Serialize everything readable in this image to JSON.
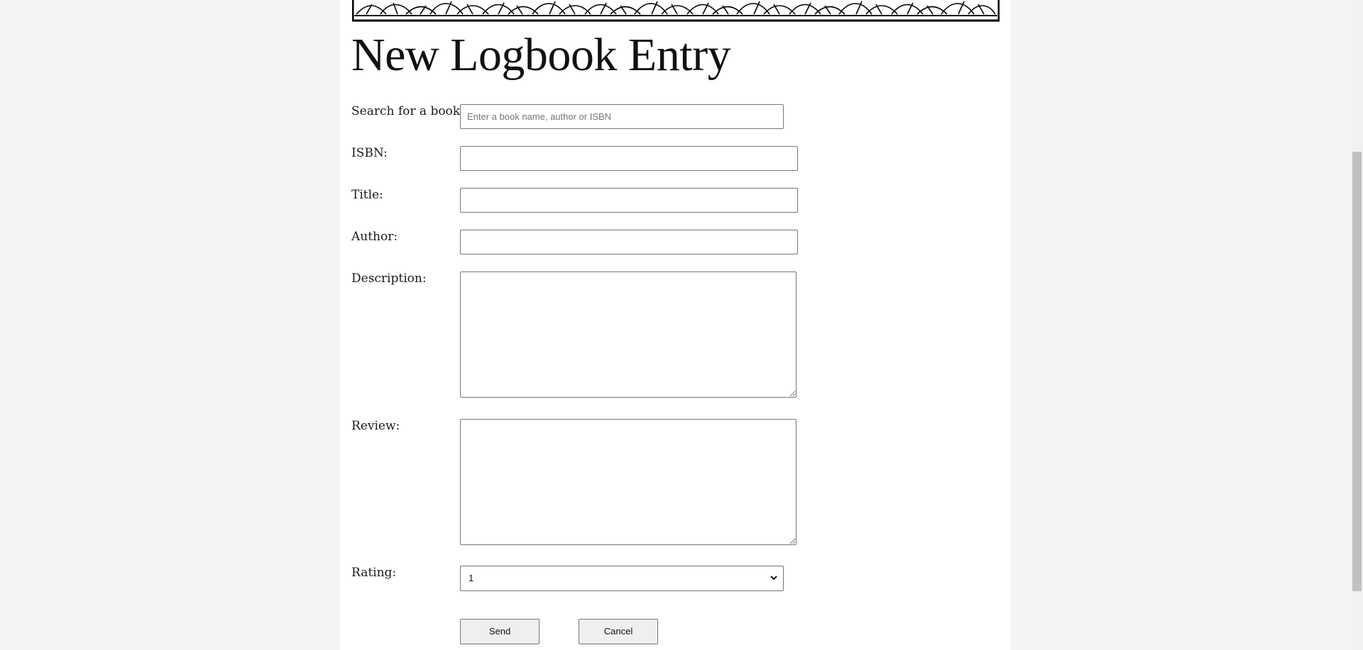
{
  "page": {
    "heading": "New Logbook Entry"
  },
  "form": {
    "search": {
      "label": "Search for a book:",
      "placeholder": "Enter a book name, author or ISBN",
      "value": ""
    },
    "isbn": {
      "label": "ISBN:",
      "value": ""
    },
    "title": {
      "label": "Title:",
      "value": ""
    },
    "author": {
      "label": "Author:",
      "value": ""
    },
    "description": {
      "label": "Description:",
      "value": ""
    },
    "review": {
      "label": "Review:",
      "value": ""
    },
    "rating": {
      "label": "Rating:",
      "selected": "1"
    },
    "send_label": "Send",
    "cancel_label": "Cancel"
  },
  "icons": {
    "banner": "decorative-leaf-banner",
    "select_arrow": "chevron-down-icon"
  }
}
